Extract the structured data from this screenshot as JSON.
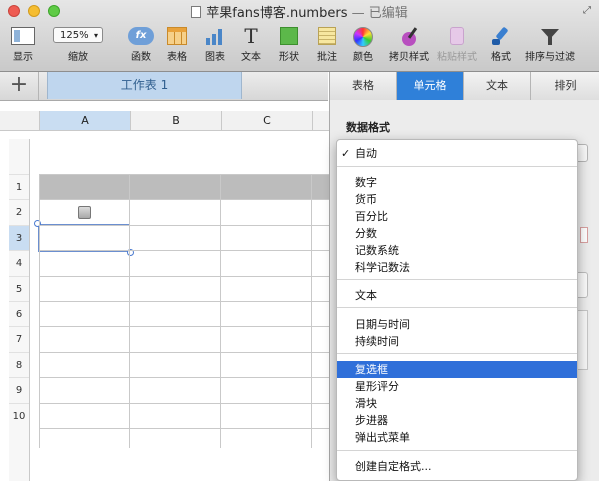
{
  "window": {
    "title": "苹果fans博客.numbers",
    "title_suffix": " — 已编辑"
  },
  "toolbar": {
    "zoom_value": "125%",
    "items": [
      {
        "label": "显示",
        "icon": "view-icon"
      },
      {
        "label": "缩放",
        "icon": "zoom-select"
      },
      {
        "label": "函数",
        "icon": "function-icon"
      },
      {
        "label": "表格",
        "icon": "table-icon"
      },
      {
        "label": "图表",
        "icon": "chart-icon"
      },
      {
        "label": "文本",
        "icon": "text-icon"
      },
      {
        "label": "形状",
        "icon": "shape-icon"
      },
      {
        "label": "批注",
        "icon": "comment-icon"
      },
      {
        "label": "颜色",
        "icon": "color-wheel-icon"
      },
      {
        "label": "拷贝样式",
        "icon": "copy-style-icon"
      },
      {
        "label": "粘贴样式",
        "icon": "paste-style-icon"
      },
      {
        "label": "格式",
        "icon": "format-brush-icon"
      },
      {
        "label": "排序与过滤",
        "icon": "filter-icon"
      }
    ],
    "function_glyph": "fx",
    "text_glyph": "T"
  },
  "sheets": {
    "add": "+",
    "active": "工作表 1"
  },
  "columns": [
    "A",
    "B",
    "C"
  ],
  "rows": [
    "1",
    "2",
    "3",
    "4",
    "5",
    "6",
    "7",
    "8",
    "9",
    "10"
  ],
  "inspector": {
    "tabs": [
      "表格",
      "单元格",
      "文本",
      "排列"
    ],
    "active_tab": "单元格",
    "section_label": "数据格式"
  },
  "format_menu": {
    "checked": "自动",
    "selected": "复选框",
    "groups": [
      [
        "自动"
      ],
      [
        "数字",
        "货币",
        "百分比",
        "分数",
        "记数系统",
        "科学记数法"
      ],
      [
        "文本"
      ],
      [
        "日期与时间",
        "持续时间"
      ],
      [
        "复选框",
        "星形评分",
        "滑块",
        "步进器",
        "弹出式菜单"
      ],
      [
        "创建自定格式..."
      ]
    ]
  },
  "colors": {
    "accent": "#2f80d9",
    "menu_highlight": "#2f6fd9",
    "sheet_tab": "#bfd6ee",
    "header_row": "#bcbcbc"
  }
}
